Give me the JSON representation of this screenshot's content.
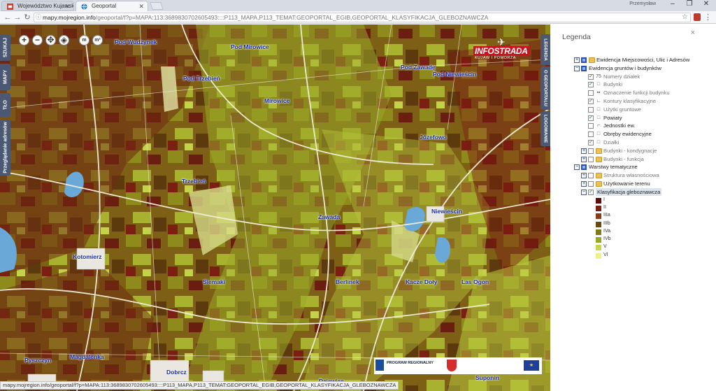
{
  "browser": {
    "tabs": [
      {
        "title": "Województwo Kujawsko",
        "active": false
      },
      {
        "title": "Geoportal",
        "active": true
      }
    ],
    "profile": "Przemysław",
    "window_controls": [
      "–",
      "❐",
      "✕"
    ],
    "url_host": "mapy.mojregion.info",
    "url_path": "/geoportal/f?p=MAPA:113:3689830702605493::::P113_MAPA,P113_TEMAT:GEOPORTAL_EGIB,GEOPORTAL_KLASYFIKACJA_GLEBOZNAWCZA"
  },
  "map": {
    "left_tabs": [
      "SZUKAJ",
      "MAPY",
      "TŁO",
      "Przeglądanie adresów"
    ],
    "right_tabs": [
      "LEGENDA",
      "O GEOPORTALU",
      "LOGOWANIE"
    ],
    "tools": [
      "+",
      "−",
      "✥",
      "◈",
      "m",
      "m²"
    ],
    "logo_brand": "INFOSTRADA",
    "logo_sub": "KUJAW I POMORZA",
    "places": [
      "Pod Wudzynek",
      "Pod Mirowice",
      "Pod Trzebień",
      "Mirowice",
      "Pod Zawadę",
      "Pod Niewieścin",
      "Józefowo",
      "Trzebień",
      "Zawada",
      "Niewieścin",
      "Kotomierz",
      "Siemaki",
      "Berlinek",
      "Kacze Doły",
      "Las Ogon",
      "Pyszczyn",
      "Magdalenka",
      "Dobrcz",
      "Dziewiec",
      "Suponin"
    ],
    "footer_program": "PROGRAM REGIONALNY",
    "eu_flag_stars": "★",
    "status_url": "mapy.mojregion.info/geoportal/f?p=MAPA:113:3689830702605493::::P113_MAPA,P113_TEMAT:GEOPORTAL_EGIB,GEOPORTAL_KLASYFIKACJA_GLEBOZNAWCZA"
  },
  "legend": {
    "title": "Legenda",
    "close": "×",
    "items": [
      {
        "label": "Ewidencja Miejscowości, Ulic i Adresów",
        "level": 0,
        "expander": "+",
        "checked": "part",
        "folder": true,
        "muted": false
      },
      {
        "label": "Ewidencja gruntów i budynków",
        "level": 0,
        "expander": "−",
        "checked": "part",
        "folder": false,
        "muted": false
      },
      {
        "label": "Numery działek",
        "level": 1,
        "icon": "75",
        "checked": "yes",
        "muted": true
      },
      {
        "label": "Budynki",
        "level": 1,
        "icon": "□",
        "checked": "yes",
        "muted": true
      },
      {
        "label": "Oznaczenie funkcji budynku",
        "level": 1,
        "icon": "▪▪",
        "checked": "no",
        "muted": true
      },
      {
        "label": "Kontury klasyfikacyjne",
        "level": 1,
        "icon": "∟",
        "checked": "yes",
        "muted": true
      },
      {
        "label": "Użytki gruntowe",
        "level": 1,
        "icon": "□",
        "checked": "no",
        "muted": true
      },
      {
        "label": "Powiaty",
        "level": 1,
        "icon": "□",
        "checked": "yes",
        "muted": false
      },
      {
        "label": "Jednostki ew.",
        "level": 1,
        "icon": "⌐",
        "checked": "no",
        "muted": false
      },
      {
        "label": "Obręby ewidencyjne",
        "level": 1,
        "icon": "□",
        "checked": "no",
        "muted": false
      },
      {
        "label": "Działki",
        "level": 1,
        "icon": "□",
        "checked": "yes",
        "muted": true
      },
      {
        "label": "Budynki - kondygnacje",
        "level": 1,
        "expander": "+",
        "checked": "no",
        "folder": true,
        "muted": true
      },
      {
        "label": "Budynki - funkcja",
        "level": 1,
        "expander": "+",
        "checked": "no",
        "folder": true,
        "muted": true
      },
      {
        "label": "Warstwy tematyczne",
        "level": 0,
        "expander": "−",
        "checked": "part",
        "folder": false,
        "muted": false
      },
      {
        "label": "Struktura własnościowa",
        "level": 1,
        "expander": "+",
        "checked": "no",
        "folder": true,
        "muted": true
      },
      {
        "label": "Użytkowanie terenu",
        "level": 1,
        "expander": "+",
        "checked": "no",
        "folder": true,
        "muted": false
      },
      {
        "label": "Klasyfikacja gleboznawcza",
        "level": 1,
        "expander": "−",
        "checked": "yes",
        "folder": false,
        "muted": false,
        "selected": true
      }
    ],
    "soil_classes": [
      {
        "label": "I",
        "color": "#5e0b0b"
      },
      {
        "label": "II",
        "color": "#7a1f12"
      },
      {
        "label": "IIIa",
        "color": "#8c3a1a"
      },
      {
        "label": "IIIb",
        "color": "#6b4a10"
      },
      {
        "label": "IVa",
        "color": "#7e7a18"
      },
      {
        "label": "IVb",
        "color": "#9aa62a"
      },
      {
        "label": "V",
        "color": "#c7d64a"
      },
      {
        "label": "VI",
        "color": "#eef08a"
      }
    ]
  },
  "colors": {
    "tab_blue": "#4a5874",
    "place_label": "#1a2d9a",
    "water": "#6aa8d8"
  }
}
